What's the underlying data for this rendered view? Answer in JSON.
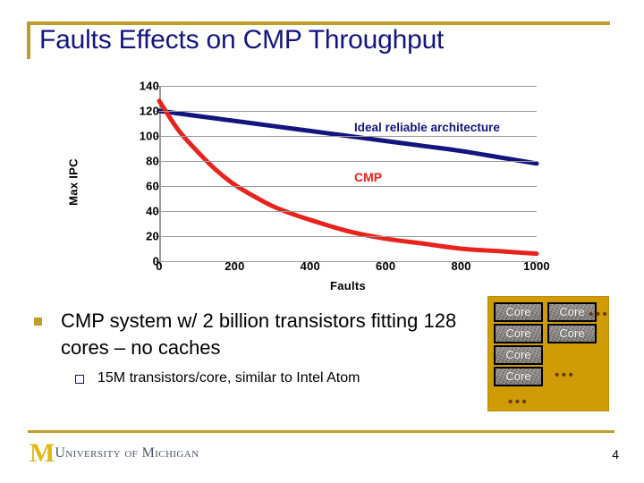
{
  "slide": {
    "title": "Faults Effects on CMP Throughput",
    "page_number": "4",
    "accent_gold": "#bf9d28",
    "title_color": "#13157f"
  },
  "chart_data": {
    "type": "line",
    "title": "",
    "xlabel": "Faults",
    "ylabel": "Max IPC",
    "xlim": [
      0,
      1000
    ],
    "ylim": [
      0,
      140
    ],
    "xticks": [
      "0",
      "200",
      "400",
      "600",
      "800",
      "1000"
    ],
    "yticks": [
      "0",
      "20",
      "40",
      "60",
      "80",
      "100",
      "120",
      "140"
    ],
    "grid": true,
    "legend_position": "inline-annotation",
    "series": [
      {
        "name": "Ideal reliable architecture",
        "color": "#13157f",
        "x": [
          0,
          100,
          200,
          300,
          400,
          500,
          600,
          700,
          800,
          900,
          1000
        ],
        "values": [
          120,
          116,
          112,
          108,
          104,
          100,
          96,
          92,
          88,
          83,
          78
        ]
      },
      {
        "name": "CMP",
        "color": "#e8221c",
        "x": [
          0,
          50,
          100,
          150,
          200,
          250,
          300,
          350,
          400,
          500,
          600,
          700,
          800,
          900,
          1000
        ],
        "values": [
          128,
          105,
          88,
          73,
          61,
          52,
          44,
          38,
          33,
          24,
          18,
          14,
          10,
          8,
          6
        ]
      }
    ],
    "annotations": [
      {
        "text": "Ideal reliable architecture",
        "color": "#13157f"
      },
      {
        "text": "CMP",
        "color": "#e8221c"
      }
    ]
  },
  "body": {
    "bullet_primary": "CMP system w/ 2 billion transistors fitting 128 cores – no caches",
    "bullet_secondary": "15M transistors/core, similar to Intel Atom"
  },
  "core_diagram": {
    "background_color": "#cf9c06",
    "core_label": "Core",
    "cores": [
      {
        "label": "Core",
        "left": 6,
        "top": 6
      },
      {
        "label": "Core",
        "left": 66,
        "top": 6
      },
      {
        "label": "Core",
        "left": 6,
        "top": 30
      },
      {
        "label": "Core",
        "left": 66,
        "top": 30
      },
      {
        "label": "Core",
        "left": 6,
        "top": 54
      },
      {
        "label": "Core",
        "left": 6,
        "top": 78
      }
    ],
    "ellipses": [
      {
        "text": "•••",
        "left": 112,
        "top": 12
      },
      {
        "text": "•••",
        "left": 74,
        "top": 80
      },
      {
        "text": "•••",
        "left": 22,
        "top": 110
      }
    ]
  },
  "footer": {
    "logo_mark": "M",
    "logo_text": "University of Michigan"
  }
}
